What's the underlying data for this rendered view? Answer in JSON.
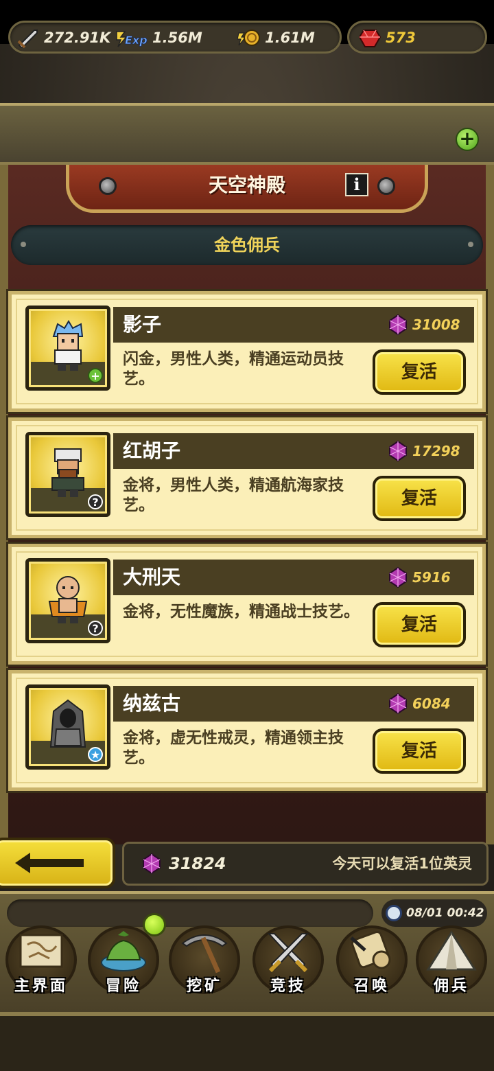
{
  "resources": {
    "power": "272.91K",
    "exp": "1.56M",
    "gold": "1.61M",
    "rubies": "573"
  },
  "icons": {
    "power": "sword-icon",
    "exp": "exp-icon",
    "gold": "coin-icon",
    "rubies": "ruby-icon",
    "add": "plus-icon",
    "info": "info-icon",
    "gem": "purple-gem-icon",
    "back": "arrow-left-icon",
    "clock": "clock-icon"
  },
  "header": {
    "title": "天空神殿",
    "info_label": "i"
  },
  "subheader": "金色佣兵",
  "heroes": [
    {
      "name": "影子",
      "cost": "31008",
      "desc": "闪金，男性人类，精通运动员技艺。",
      "button": "复活",
      "badge": "+"
    },
    {
      "name": "红胡子",
      "cost": "17298",
      "desc": "金将，男性人类，精通航海家技艺。",
      "button": "复活",
      "badge": "?"
    },
    {
      "name": "大刑天",
      "cost": "5916",
      "desc": "金将，无性魔族，精通战士技艺。",
      "button": "复活",
      "badge": "?"
    },
    {
      "name": "纳兹古",
      "cost": "6084",
      "desc": "金将，虚无性戒灵，精通领主技艺。",
      "button": "复活",
      "badge": "★"
    }
  ],
  "footer": {
    "gem_total": "31824",
    "revive_note": "今天可以复活1位英灵"
  },
  "clock": "08/01 00:42",
  "nav": [
    {
      "label": "主界面",
      "icon": "map-scroll-icon"
    },
    {
      "label": "冒险",
      "icon": "island-icon"
    },
    {
      "label": "挖矿",
      "icon": "pickaxe-icon"
    },
    {
      "label": "竞技",
      "icon": "crossed-swords-icon"
    },
    {
      "label": "召唤",
      "icon": "summon-scroll-icon"
    },
    {
      "label": "佣兵",
      "icon": "tent-icon"
    }
  ]
}
